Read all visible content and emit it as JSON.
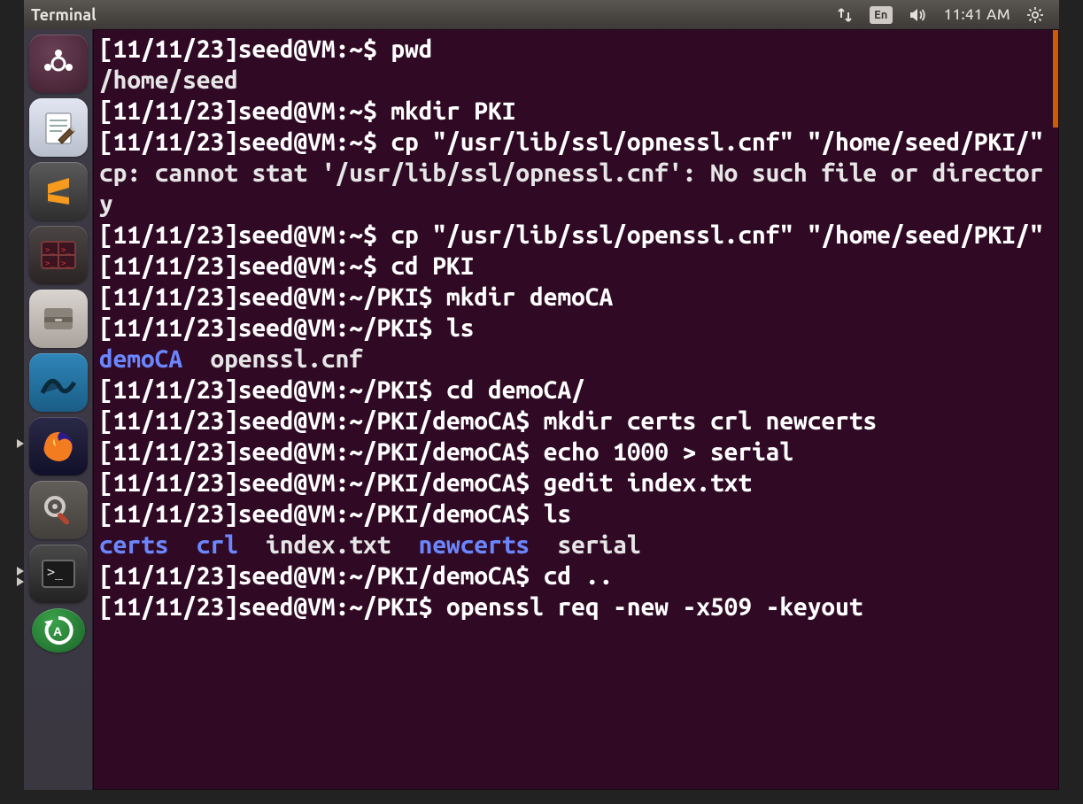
{
  "menubar": {
    "title": "Terminal",
    "lang": "En",
    "clock": "11:41 AM"
  },
  "launcher": {
    "items": [
      {
        "name": "dash",
        "label": "Dash"
      },
      {
        "name": "gedit",
        "label": "Text Editor"
      },
      {
        "name": "sublime",
        "label": "Sublime Text"
      },
      {
        "name": "terminator",
        "label": "Terminator"
      },
      {
        "name": "files",
        "label": "Files"
      },
      {
        "name": "wireshark",
        "label": "Wireshark"
      },
      {
        "name": "firefox",
        "label": "Firefox"
      },
      {
        "name": "settings",
        "label": "System Settings"
      },
      {
        "name": "term",
        "label": "Terminal"
      },
      {
        "name": "update",
        "label": "Software Updater"
      }
    ]
  },
  "terminal": {
    "lines": [
      {
        "type": "prompt",
        "date": "[11/11/23]",
        "userhost": "seed@VM",
        "path": "~",
        "cmd": "pwd"
      },
      {
        "type": "out",
        "text": "/home/seed"
      },
      {
        "type": "prompt",
        "date": "[11/11/23]",
        "userhost": "seed@VM",
        "path": "~",
        "cmd": "mkdir PKI"
      },
      {
        "type": "prompt",
        "date": "[11/11/23]",
        "userhost": "seed@VM",
        "path": "~",
        "cmd": "cp \"/usr/lib/ssl/opnessl.cnf\" \"/home/seed/PKI/\""
      },
      {
        "type": "out",
        "text": "cp: cannot stat '/usr/lib/ssl/opnessl.cnf': No such file or directory"
      },
      {
        "type": "prompt",
        "date": "[11/11/23]",
        "userhost": "seed@VM",
        "path": "~",
        "cmd": "cp \"/usr/lib/ssl/openssl.cnf\" \"/home/seed/PKI/\""
      },
      {
        "type": "prompt",
        "date": "[11/11/23]",
        "userhost": "seed@VM",
        "path": "~",
        "cmd": "cd PKI"
      },
      {
        "type": "prompt",
        "date": "[11/11/23]",
        "userhost": "seed@VM",
        "path": "~/PKI",
        "cmd": "mkdir demoCA"
      },
      {
        "type": "prompt",
        "date": "[11/11/23]",
        "userhost": "seed@VM",
        "path": "~/PKI",
        "cmd": "ls"
      },
      {
        "type": "ls",
        "items": [
          {
            "t": "demoCA",
            "dir": true
          },
          {
            "t": "  openssl.cnf",
            "dir": false
          }
        ]
      },
      {
        "type": "prompt",
        "date": "[11/11/23]",
        "userhost": "seed@VM",
        "path": "~/PKI",
        "cmd": "cd demoCA/"
      },
      {
        "type": "prompt",
        "date": "[11/11/23]",
        "userhost": "seed@VM",
        "path": "~/PKI/demoCA",
        "cmd": "mkdir certs crl newcerts"
      },
      {
        "type": "prompt",
        "date": "[11/11/23]",
        "userhost": "seed@VM",
        "path": "~/PKI/demoCA",
        "cmd": "echo 1000 > serial"
      },
      {
        "type": "prompt",
        "date": "[11/11/23]",
        "userhost": "seed@VM",
        "path": "~/PKI/demoCA",
        "cmd": "gedit index.txt"
      },
      {
        "type": "prompt",
        "date": "[11/11/23]",
        "userhost": "seed@VM",
        "path": "~/PKI/demoCA",
        "cmd": "ls"
      },
      {
        "type": "ls",
        "items": [
          {
            "t": "certs",
            "dir": true
          },
          {
            "t": "  crl",
            "dir": true
          },
          {
            "t": "  index.txt",
            "dir": false
          },
          {
            "t": "  newcerts",
            "dir": true
          },
          {
            "t": "  serial",
            "dir": false
          }
        ]
      },
      {
        "type": "prompt",
        "date": "[11/11/23]",
        "userhost": "seed@VM",
        "path": "~/PKI/demoCA",
        "cmd": "cd .."
      },
      {
        "type": "prompt",
        "date": "[11/11/23]",
        "userhost": "seed@VM",
        "path": "~/PKI",
        "cmd": "openssl req -new -x509 -keyout"
      }
    ]
  }
}
